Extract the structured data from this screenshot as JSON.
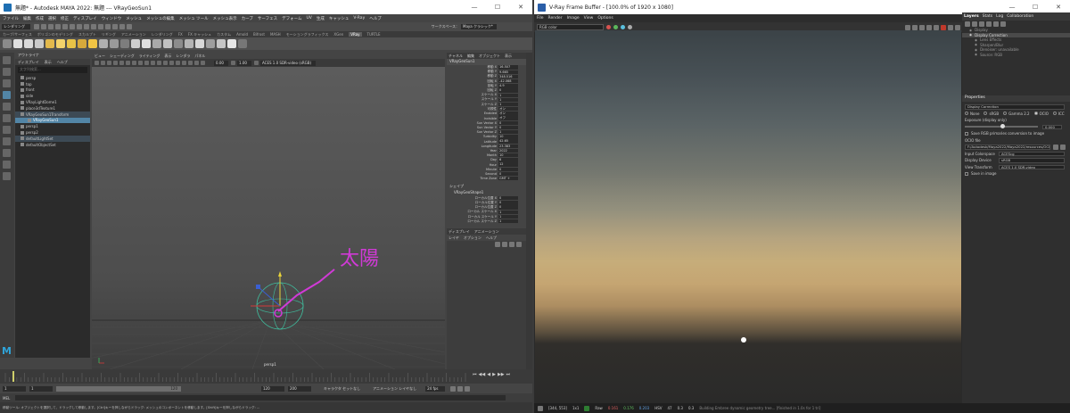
{
  "maya": {
    "title": "無題* - Autodesk MAYA 2022: 無題 --- VRayGeoSun1",
    "menus": [
      "ファイル",
      "編集",
      "作成",
      "選択",
      "修正",
      "ディスプレイ",
      "ウィンドウ",
      "メッシュ",
      "メッシュの編集",
      "メッシュ ツール",
      "メッシュ表示",
      "カーブ",
      "サーフェス",
      "デフォーム",
      "UV",
      "生成",
      "キャッシュ",
      "V-Ray",
      "ヘルプ"
    ],
    "workspace_label": "ワークスペース：",
    "workspace_value": "Maya クラシック*",
    "mode_select": "レンダリング",
    "shelf_tabs": [
      "カーブ/サーフェス",
      "ポリゴンのモデリング",
      "スカルプト",
      "リギング",
      "アニメーション",
      "レンダリング",
      "FX",
      "FX キャッシュ",
      "カスタム",
      "Arnold",
      "Bifrost",
      "MASH",
      "モーショングラフィックス",
      "XGen",
      "VRay",
      "TURTLE"
    ],
    "shelf_active": "VRay",
    "outliner": {
      "header": "アウトライナ",
      "menu": [
        "ディスプレイ",
        "表示",
        "ヘルプ"
      ],
      "search_placeholder": "文字列検索...",
      "items": [
        "persp",
        "top",
        "front",
        "side",
        "VRayLightDome1",
        "place3dTexture1",
        "VRayGeoSun1Transform",
        "VRayGeoSun1",
        "persp1",
        "persp2",
        "defaultLightSet",
        "defaultObjectSet"
      ],
      "selected": "VRayGeoSun1",
      "highlighted": [
        "VRayGeoSun1Transform",
        "defaultLightSet"
      ]
    },
    "viewport": {
      "menu": [
        "ビュー",
        "シェーディング",
        "ライティング",
        "表示",
        "レンダラ",
        "パネル"
      ],
      "field1": "0.00",
      "field2": "1.00",
      "colorspace": "ACES 1.0 SDR-video (sRGB)",
      "camera_label": "persp1",
      "annotation": "太陽"
    },
    "attr": {
      "tabs": [
        "チャネル",
        "編集",
        "オブジェクト",
        "表示"
      ],
      "node": "VRayGeoSun1",
      "rows": [
        {
          "label": "移動 X",
          "value": "16.507"
        },
        {
          "label": "移動 Y",
          "value": "9.665"
        },
        {
          "label": "移動 Z",
          "value": "348.516"
        },
        {
          "label": "回転 X",
          "value": "-42.068"
        },
        {
          "label": "回転 Y",
          "value": "4.9"
        },
        {
          "label": "回転 Z",
          "value": "0"
        },
        {
          "label": "スケール X",
          "value": "1"
        },
        {
          "label": "スケール Y",
          "value": "1"
        },
        {
          "label": "スケール Z",
          "value": "1"
        },
        {
          "label": "可視性",
          "value": "オン"
        },
        {
          "label": "Enabled",
          "value": "オン"
        },
        {
          "label": "Invisible",
          "value": "オフ"
        },
        {
          "label": "Sun Vector X",
          "value": "0"
        },
        {
          "label": "Sun Vector Y",
          "value": "0"
        },
        {
          "label": "Sun Vector Z",
          "value": "1"
        },
        {
          "label": "Turbidity",
          "value": "10"
        },
        {
          "label": "Latitude",
          "value": "42.65"
        },
        {
          "label": "Longitude",
          "value": "23.383"
        },
        {
          "label": "Year",
          "value": "2022"
        },
        {
          "label": "Month",
          "value": "10"
        },
        {
          "label": "Day",
          "value": "6"
        },
        {
          "label": "Hour",
          "value": "12"
        },
        {
          "label": "Minute",
          "value": "0"
        },
        {
          "label": "Second",
          "value": "0"
        },
        {
          "label": "Time Zone",
          "value": "GMT +"
        }
      ],
      "shapes_label": "シェイプ",
      "shape_node": "VRayGeoShape1",
      "local_rows": [
        {
          "label": "ローカル位置 X",
          "value": "0"
        },
        {
          "label": "ローカル位置 Y",
          "value": "0"
        },
        {
          "label": "ローカル位置 Z",
          "value": "0"
        },
        {
          "label": "ローカル スケール X",
          "value": "1"
        },
        {
          "label": "ローカル スケール Y",
          "value": "1"
        },
        {
          "label": "ローカル スケール Z",
          "value": "1"
        }
      ],
      "layer_tabs": [
        "ディスプレイ",
        "アニメーション"
      ],
      "layer_menu": [
        "レイヤ",
        "オプション",
        "ヘルプ"
      ]
    },
    "timeline": {
      "start": "1",
      "current": "1",
      "range_start": "1",
      "range_inner": "120",
      "range_end": "120",
      "anim_end": "200",
      "character_set": "キャラクタ セットなし",
      "anim_layer": "アニメーション レイヤなし",
      "fps": "24 fps"
    },
    "cmd_label": "MEL",
    "help_text": "移動ツール: オブジェクトを選択して、ドラッグして移動します。[Ctrl]キーを押しながらドラッグ: メッシュのコンポーネントを移動します。[Shift]キーを押しながらドラッグ: ..."
  },
  "vfb": {
    "title": "V-Ray Frame Buffer - [100.0% of 1920 x 1080]",
    "menus": [
      "File",
      "Render",
      "Image",
      "View",
      "Options"
    ],
    "channel": "RGB color",
    "dot_colors": [
      "#d9534f",
      "#5cb85c",
      "#5bc0de"
    ],
    "right_tabs": [
      "Layers",
      "Stats",
      "Log",
      "Collaboration"
    ],
    "layers": [
      "Display",
      "Display Correction",
      "Lens Effects",
      "Sharpen/Blur",
      "Denoiser: unavailable",
      "Source: RGB"
    ],
    "selected_layer": "Display Correction",
    "properties": {
      "header": "Properties",
      "section": "Display Correction",
      "modes": [
        "None",
        "sRGB",
        "Gamma 2.2",
        "OCIO",
        "ICC"
      ],
      "mode_selected": "OCIO",
      "exposure_label": "Exposure (display only)",
      "exposure_value": "0.000",
      "save_rgb_label": "Save RGB primaries conversion to image",
      "ocio_label": "OCIO file",
      "ocio_path": "F:/Autodesk/Maya2022/Maya2022/resources/OCIO-configs/aces_1.2/config.ocio",
      "input_colorspace_label": "Input Colorspace",
      "input_colorspace": "ACEScg",
      "display_device_label": "Display Device",
      "display_device": "sRGB",
      "view_transform_label": "View Transform",
      "view_transform": "ACES 1.0 SDR-video",
      "save_image_label": "Save in image"
    },
    "status": {
      "coords": "[344, 553]",
      "mode": "1x1",
      "raw_label": "Raw",
      "r": "0.161",
      "g": "0.176",
      "b": "0.203",
      "hsv_label": "HSV",
      "h": "47",
      "s": "0.3",
      "v": "0.3",
      "message": "Building Embree dynamic geometry tree... [finished in 1.0s for 1 tri]"
    }
  }
}
